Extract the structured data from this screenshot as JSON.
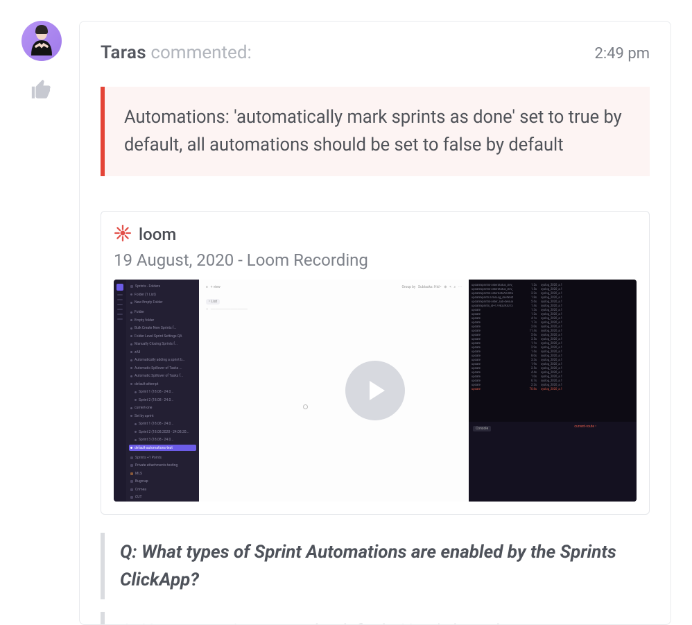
{
  "comment": {
    "author": "Taras",
    "action_label": "commented:",
    "time": "2:49 pm",
    "quote_text": "Automations: 'automatically mark sprints as done' set to true by default, all automations should be set to false by default"
  },
  "loom": {
    "brand": "loom",
    "title": "19 August, 2020 - Loom Recording"
  },
  "qa": {
    "question": "Q: What types of Sprint Automations are enabled by the Sprints ClickApp?",
    "answer_partial": "A: No automation are on by default. Here's how the"
  },
  "icons": {
    "like": "thumbs-up-icon",
    "loom": "loom-logo-icon",
    "play": "play-icon"
  }
}
